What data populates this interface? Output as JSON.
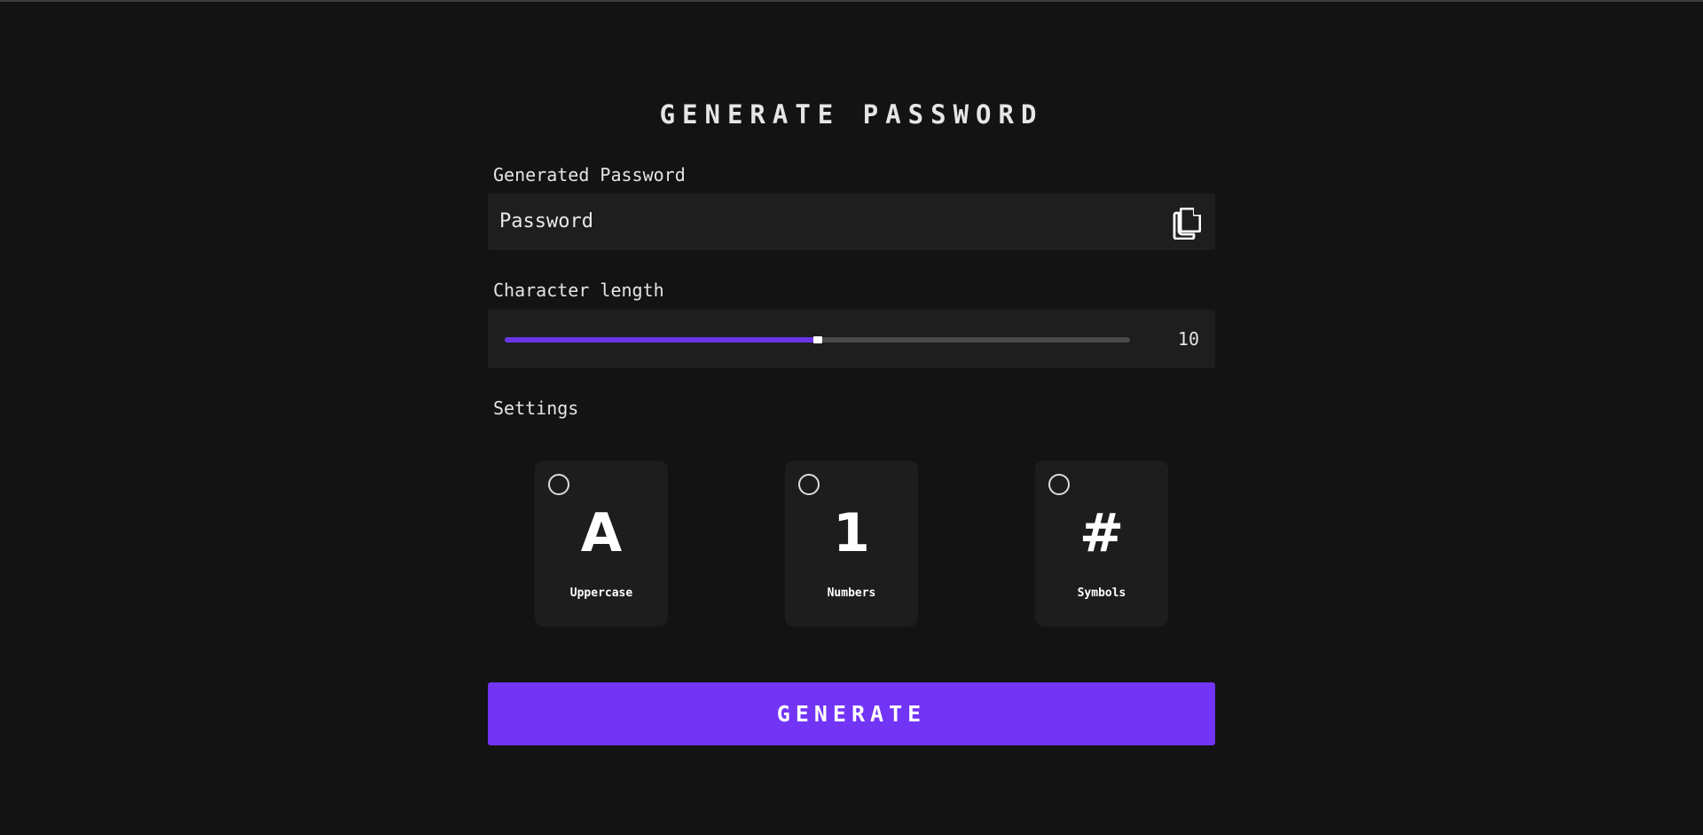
{
  "title": "GENERATE PASSWORD",
  "password": {
    "label": "Generated Password",
    "placeholder": "Password",
    "value": "",
    "copy_icon": "copy-icon"
  },
  "length": {
    "label": "Character length",
    "value": "10",
    "fill_fraction": 0.5
  },
  "settings": {
    "label": "Settings",
    "options": [
      {
        "glyph": "A",
        "label": "Uppercase",
        "checked": false
      },
      {
        "glyph": "1",
        "label": "Numbers",
        "checked": false
      },
      {
        "glyph": "#",
        "label": "Symbols",
        "checked": false
      }
    ]
  },
  "generate_button": {
    "label": "GENERATE"
  },
  "colors": {
    "background": "#131313",
    "panel": "#1e1e1e",
    "accent": "#7234f5",
    "slider_fill": "#6a35e6",
    "text": "#e8e8e8"
  }
}
